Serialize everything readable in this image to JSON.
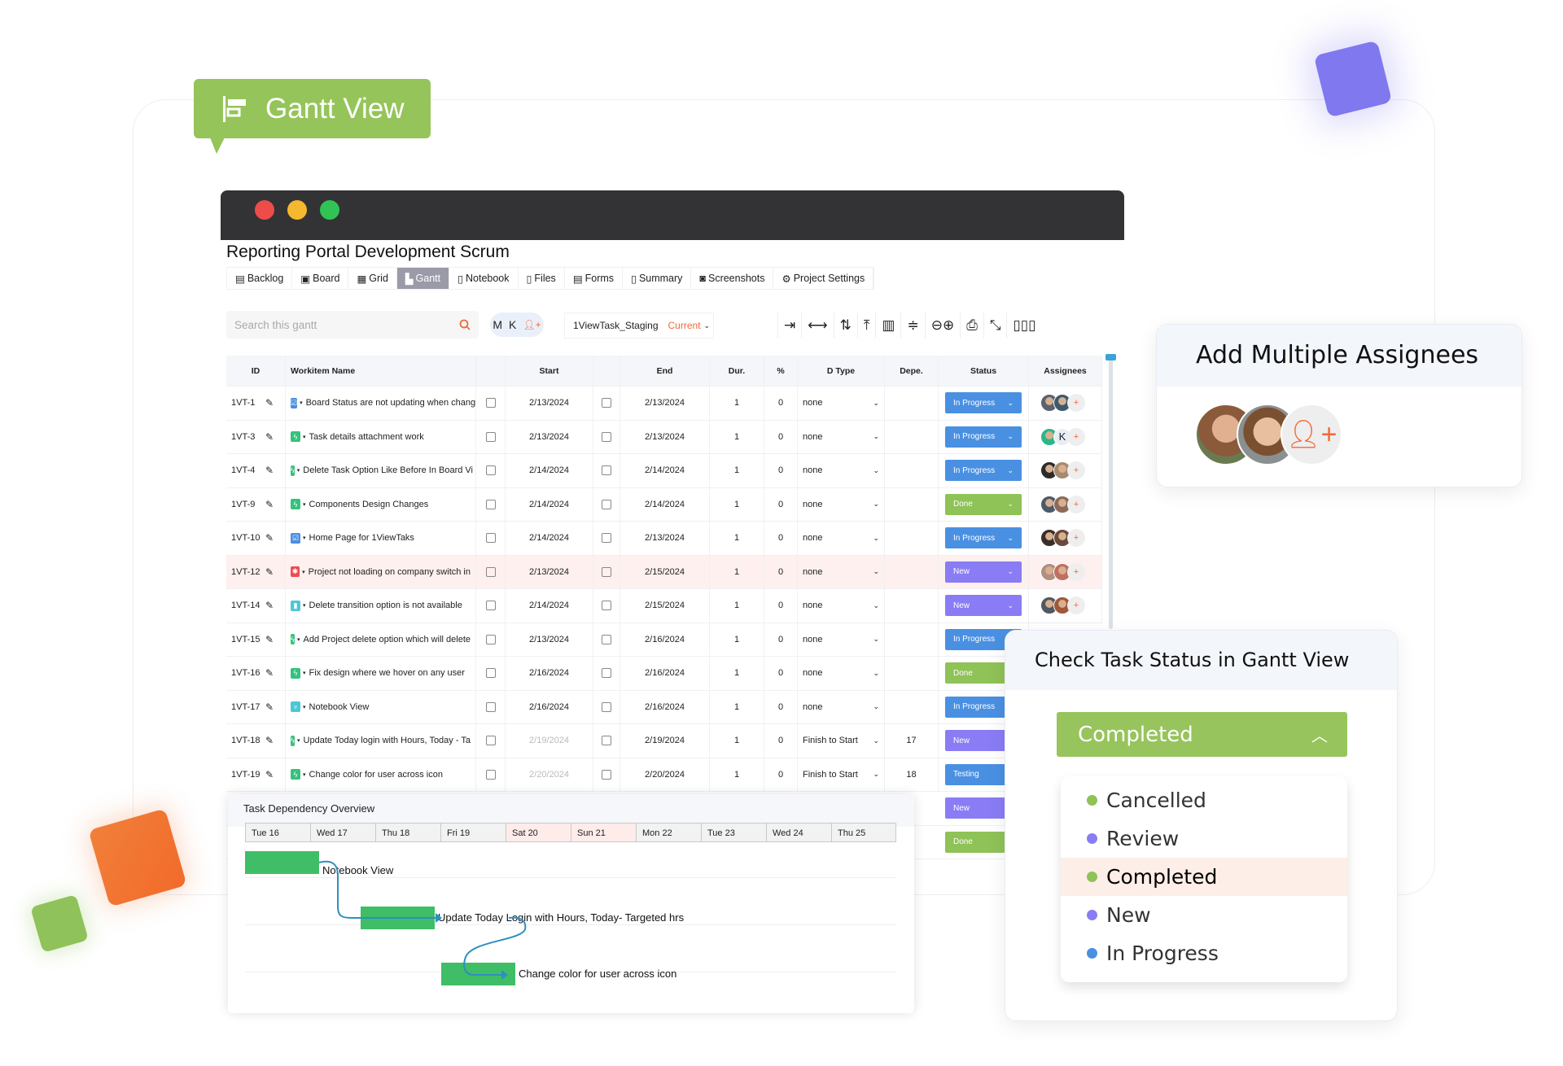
{
  "badge": {
    "label": "Gantt View",
    "icon": "gantt-icon"
  },
  "window": {
    "dots": [
      "#ee4b4b",
      "#f5b82e",
      "#2fc454"
    ]
  },
  "project": {
    "title": "Reporting Portal Development Scrum"
  },
  "tabs": [
    {
      "label": "Backlog",
      "icon": "backlog-icon",
      "glyph": "▤"
    },
    {
      "label": "Board",
      "icon": "board-icon",
      "glyph": "▣"
    },
    {
      "label": "Grid",
      "icon": "grid-icon",
      "glyph": "▦"
    },
    {
      "label": "Gantt",
      "icon": "gantt-icon",
      "glyph": "▙",
      "active": true
    },
    {
      "label": "Notebook",
      "icon": "notebook-icon",
      "glyph": "▯"
    },
    {
      "label": "Files",
      "icon": "file-icon",
      "glyph": "▯"
    },
    {
      "label": "Forms",
      "icon": "form-icon",
      "glyph": "▤"
    },
    {
      "label": "Summary",
      "icon": "summary-icon",
      "glyph": "▯"
    },
    {
      "label": "Screenshots",
      "icon": "camera-icon",
      "glyph": "◙"
    },
    {
      "label": "Project Settings",
      "icon": "gear-icon",
      "glyph": "⚙"
    }
  ],
  "search": {
    "placeholder": "Search this gantt"
  },
  "users": {
    "initials": [
      "M",
      "K"
    ]
  },
  "environment": {
    "name": "1ViewTask_Staging",
    "version": "Current"
  },
  "toolbar": [
    {
      "icon": "indent-icon",
      "glyph": "⇥"
    },
    {
      "icon": "expand-width-icon",
      "glyph": "⟷"
    },
    {
      "icon": "sort-icon",
      "glyph": "⇅"
    },
    {
      "icon": "fit-icon",
      "glyph": "⤒"
    },
    {
      "icon": "trash-icon",
      "glyph": "▥"
    },
    {
      "icon": "collapse-icon",
      "glyph": "≑"
    },
    {
      "icon": "zoom-icon",
      "glyph": "⊖⊕"
    },
    {
      "icon": "print-icon",
      "glyph": "⎙"
    },
    {
      "icon": "fullscreen-icon",
      "glyph": "⤡"
    },
    {
      "icon": "columns-icon",
      "glyph": "▯▯▯"
    }
  ],
  "table": {
    "headers": {
      "id": "ID",
      "name": "Workitem Name",
      "start": "Start",
      "end": "End",
      "dur": "Dur.",
      "pct": "%",
      "dtype": "D Type",
      "dep": "Depe.",
      "status": "Status",
      "assignees": "Assignees"
    },
    "rows": [
      {
        "id": "1VT-1",
        "type": "task",
        "name": "Board Status are not updating when change",
        "start": "2/13/2024",
        "end": "2/13/2024",
        "dur": "1",
        "pct": "0",
        "dtype": "none",
        "dep": "",
        "status": "In Progress",
        "avatars": [
          "#5a6470",
          "#3c5a6e"
        ]
      },
      {
        "id": "1VT-3",
        "type": "feature",
        "name": "Task details attachment work",
        "start": "2/13/2024",
        "end": "2/13/2024",
        "dur": "1",
        "pct": "0",
        "dtype": "none",
        "dep": "",
        "status": "In Progress",
        "avatars": [
          "#2fb58a",
          "K"
        ]
      },
      {
        "id": "1VT-4",
        "type": "feature",
        "name": "Delete Task Option Like Before In Board Vi",
        "start": "2/14/2024",
        "end": "2/14/2024",
        "dur": "1",
        "pct": "0",
        "dtype": "none",
        "dep": "",
        "status": "In Progress",
        "avatars": [
          "#2b2b2b",
          "#a88a70"
        ]
      },
      {
        "id": "1VT-9",
        "type": "feature",
        "name": "Components Design Changes",
        "start": "2/14/2024",
        "end": "2/14/2024",
        "dur": "1",
        "pct": "0",
        "dtype": "none",
        "dep": "",
        "status": "Done",
        "avatars": [
          "#4a5a6a",
          "#8c6a5a"
        ]
      },
      {
        "id": "1VT-10",
        "type": "task",
        "name": "Home Page for 1ViewTaks",
        "start": "2/14/2024",
        "end": "2/13/2024",
        "dur": "1",
        "pct": "0",
        "dtype": "none",
        "dep": "",
        "status": "In Progress",
        "avatars": [
          "#3a2e28",
          "#6a4a3a"
        ]
      },
      {
        "id": "1VT-12",
        "type": "bug",
        "name": "Project not loading on company switch in",
        "start": "2/13/2024",
        "end": "2/15/2024",
        "dur": "1",
        "pct": "0",
        "dtype": "none",
        "dep": "",
        "status": "New",
        "avatars": [
          "#b09080",
          "#c07060"
        ],
        "highlight": true
      },
      {
        "id": "1VT-14",
        "type": "story",
        "name": "Delete transition option is not available",
        "start": "2/14/2024",
        "end": "2/15/2024",
        "dur": "1",
        "pct": "0",
        "dtype": "none",
        "dep": "",
        "status": "New",
        "avatars": [
          "#505860",
          "#a0583a"
        ]
      },
      {
        "id": "1VT-15",
        "type": "feature",
        "name": "Add Project delete option which will delete",
        "start": "2/13/2024",
        "end": "2/16/2024",
        "dur": "1",
        "pct": "0",
        "dtype": "none",
        "dep": "",
        "status": "In Progress",
        "avatars": []
      },
      {
        "id": "1VT-16",
        "type": "feature",
        "name": "Fix design where we hover on any user",
        "start": "2/16/2024",
        "end": "2/16/2024",
        "dur": "1",
        "pct": "0",
        "dtype": "none",
        "dep": "",
        "status": "Done",
        "avatars": []
      },
      {
        "id": "1VT-17",
        "type": "epic",
        "name": "Notebook View",
        "start": "2/16/2024",
        "end": "2/16/2024",
        "dur": "1",
        "pct": "0",
        "dtype": "none",
        "dep": "",
        "status": "In Progress",
        "avatars": []
      },
      {
        "id": "1VT-18",
        "type": "feature",
        "name": "Update Today login with Hours, Today - Ta",
        "start": "2/19/2024",
        "end": "2/19/2024",
        "dur": "1",
        "pct": "0",
        "dtype": "Finish to Start",
        "dep": "17",
        "status": "New",
        "avatars": [],
        "muted_start": true
      },
      {
        "id": "1VT-19",
        "type": "feature",
        "name": "Change color for user across icon",
        "start": "2/20/2024",
        "end": "2/20/2024",
        "dur": "1",
        "pct": "0",
        "dtype": "Finish to Start",
        "dep": "18",
        "status": "Testing",
        "avatars": [],
        "muted_start": true
      },
      {
        "status": "New"
      },
      {
        "status": "Done"
      }
    ]
  },
  "status_colors": {
    "In Progress": "#4a90e2",
    "Done": "#8fc257",
    "New": "#8a7cf4",
    "Testing": "#4a90e2"
  },
  "type_colors": {
    "task": "#4a8fe0",
    "feature": "#35c27e",
    "bug": "#ee4b55",
    "story": "#4cc7d6",
    "epic": "#4cc7d6"
  },
  "dependency": {
    "title": "Task Dependency Overview",
    "days": [
      {
        "label": "Tue 16"
      },
      {
        "label": "Wed 17"
      },
      {
        "label": "Thu 18"
      },
      {
        "label": "Fri 19"
      },
      {
        "label": "Sat 20",
        "weekend": true
      },
      {
        "label": "Sun 21",
        "weekend": true
      },
      {
        "label": "Mon 22"
      },
      {
        "label": "Tue 23"
      },
      {
        "label": "Wed 24"
      },
      {
        "label": "Thu 25"
      }
    ],
    "tasks": [
      {
        "label": "Notebook View",
        "start": "Tue 16"
      },
      {
        "label": "Update Today Login with Hours, Today- Targeted hrs",
        "start": "Thu 18"
      },
      {
        "label": "Change color for user across icon",
        "start": "Fri 19"
      }
    ]
  },
  "assignees_card": {
    "title": "Add Multiple Assignees"
  },
  "status_card": {
    "title": "Check Task Status in Gantt View",
    "selected": "Completed",
    "options": [
      {
        "label": "Cancelled",
        "color": "#8fc257"
      },
      {
        "label": "Review",
        "color": "#8a7cf4"
      },
      {
        "label": "Completed",
        "color": "#8fc257",
        "selected": true
      },
      {
        "label": "New",
        "color": "#8a7cf4"
      },
      {
        "label": "In Progress",
        "color": "#4a90e2"
      }
    ]
  }
}
